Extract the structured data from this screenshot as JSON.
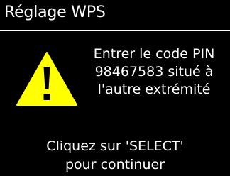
{
  "header": {
    "title": "Réglage WPS"
  },
  "message": {
    "icon": "warning-icon",
    "lines": [
      "Entrer le code PIN",
      "98467583 situé à",
      "l'autre extrémité"
    ]
  },
  "instruction": {
    "lines": [
      "Cliquez sur 'SELECT'",
      "pour continuer"
    ]
  },
  "colors": {
    "background": "#000000",
    "text": "#ffffff",
    "warning_fill": "#ffff00",
    "warning_mark": "#000000"
  }
}
